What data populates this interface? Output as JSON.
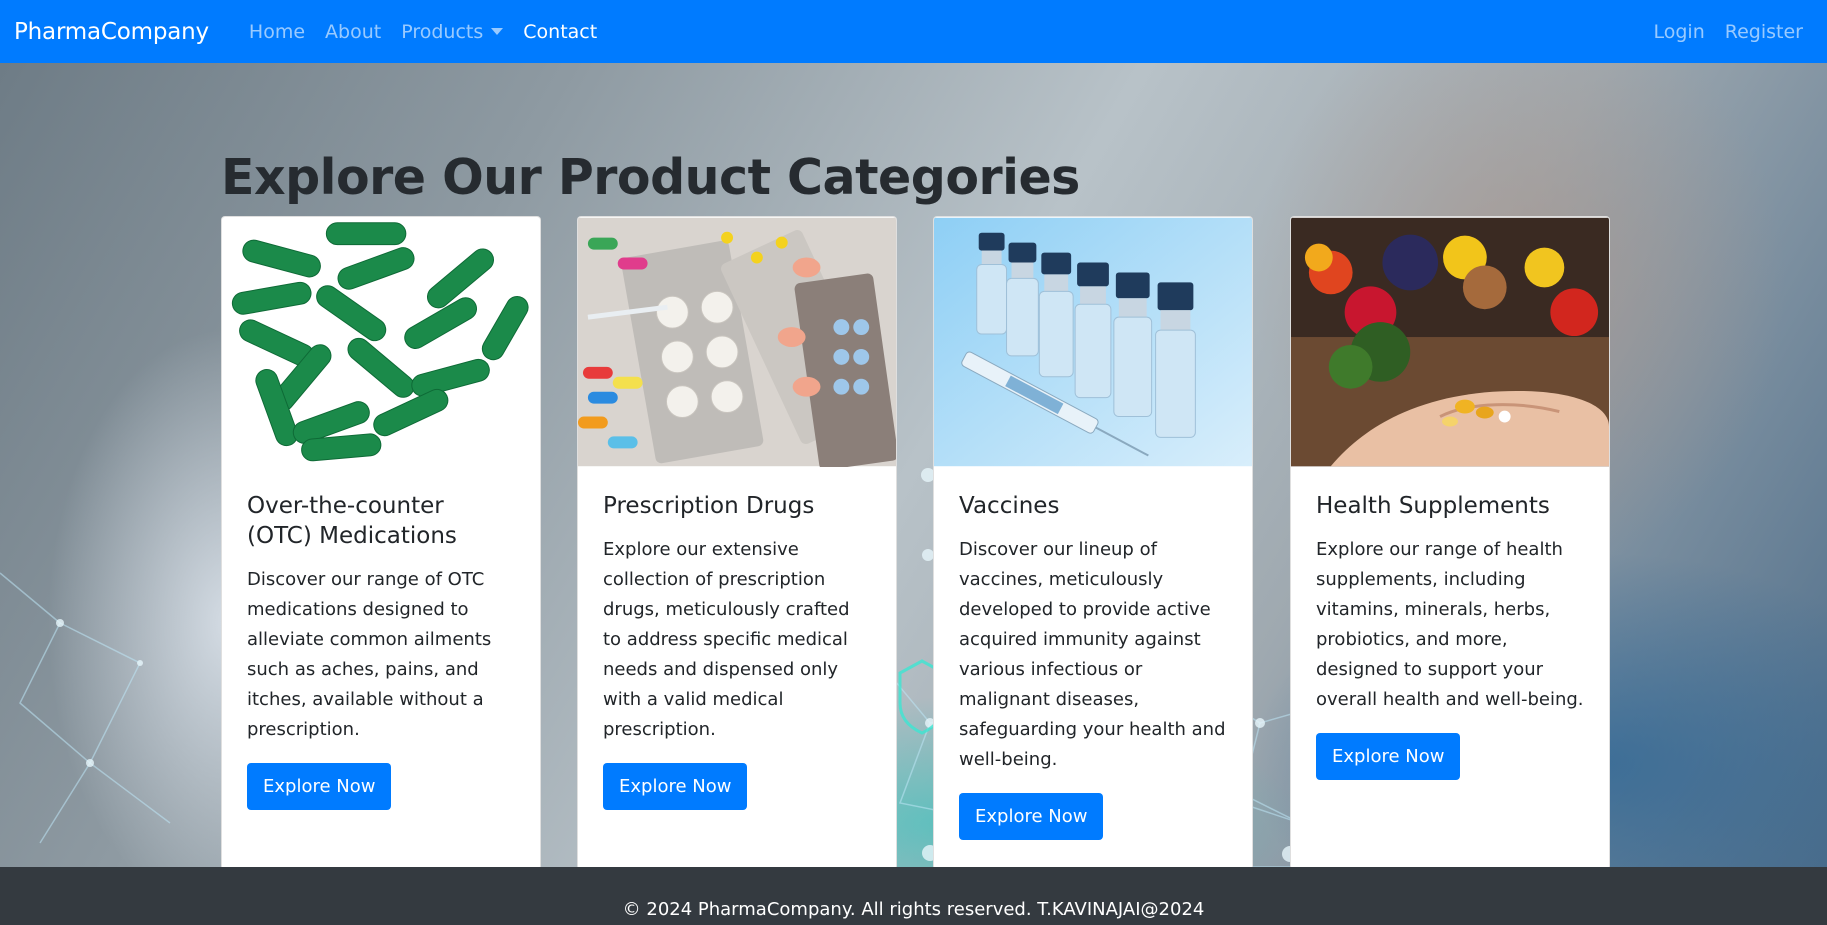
{
  "nav": {
    "brand": "PharmaCompany",
    "links": [
      "Home",
      "About",
      "Products",
      "Contact"
    ],
    "right_links": [
      "Login",
      "Register"
    ]
  },
  "page": {
    "heading": "Explore Our Product Categories"
  },
  "cards": [
    {
      "title": "Over-the-counter (OTC) Medications",
      "text": "Discover our range of OTC medications designed to alleviate common ailments such as aches, pains, and itches, available without a prescription.",
      "button": "Explore Now"
    },
    {
      "title": "Prescription Drugs",
      "text": "Explore our extensive collection of prescription drugs, meticulously crafted to address specific medical needs and dispensed only with a valid medical prescription.",
      "button": "Explore Now"
    },
    {
      "title": "Vaccines",
      "text": "Discover our lineup of vaccines, meticulously developed to provide active acquired immunity against various infectious or malignant diseases, safeguarding your health and well-being.",
      "button": "Explore Now"
    },
    {
      "title": "Health Supplements",
      "text": "Explore our range of health supplements, including vitamins, minerals, herbs, probiotics, and more, designed to support your overall health and well-being.",
      "button": "Explore Now"
    }
  ],
  "footer": {
    "text": "© 2024 PharmaCompany. All rights reserved. T.KAVINAJAI@2024"
  },
  "colors": {
    "primary": "#007bff",
    "footer_bg": "#343a40",
    "heading": "#262b30"
  }
}
